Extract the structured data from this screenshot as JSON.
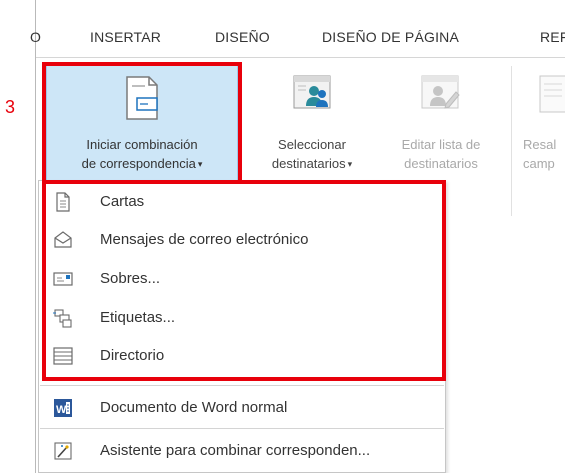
{
  "ribbon_tabs": [
    "O",
    "INSERTAR",
    "DISEÑO",
    "DISEÑO DE PÁGINA",
    "REF"
  ],
  "step_label": "3",
  "ribbon_buttons": {
    "iniciar": {
      "line1": "Iniciar combinación",
      "line2": "de correspondencia",
      "caret": "▾"
    },
    "seleccionar": {
      "line1": "Seleccionar",
      "line2": "destinatarios",
      "caret": "▾"
    },
    "editar": {
      "line1": "Editar lista de",
      "line2": "destinatarios"
    },
    "resaltar": {
      "line1": "Resal",
      "line2": "camp"
    }
  },
  "menu": {
    "items": [
      {
        "label": "Cartas",
        "icon": "document-icon"
      },
      {
        "label": "Mensajes de correo electrónico",
        "icon": "envelope-icon"
      },
      {
        "label": "Sobres...",
        "icon": "envelope-front-icon"
      },
      {
        "label": "Etiquetas...",
        "icon": "labels-icon"
      },
      {
        "label": "Directorio",
        "icon": "directory-icon"
      },
      {
        "label": "Documento de Word normal",
        "icon": "word-icon"
      },
      {
        "label": "Asistente para combinar corresponden...",
        "icon": "wizard-icon"
      }
    ]
  },
  "colors": {
    "highlight_red": "#e8000b",
    "pressed_button_bg": "#cde6f7",
    "word_blue": "#2b579a",
    "people_teal": "#2a8b9b"
  }
}
